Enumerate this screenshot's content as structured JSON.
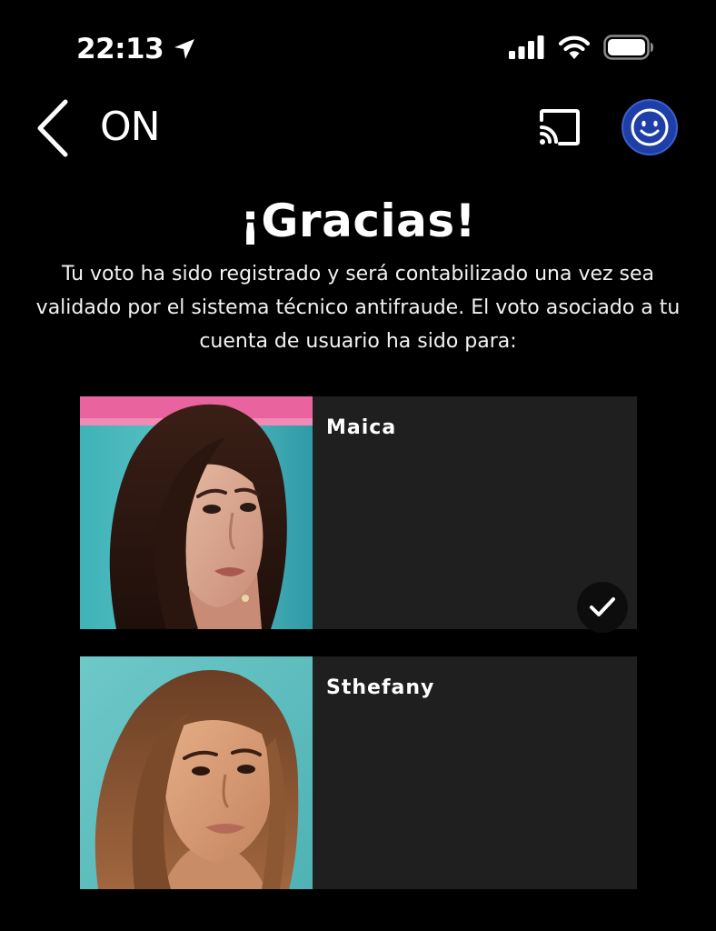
{
  "status_bar": {
    "time": "22:13",
    "icons": [
      "location-arrow-icon",
      "cellular-signal-icon",
      "wifi-icon",
      "battery-icon"
    ]
  },
  "nav": {
    "title": "ON",
    "back_icon": "chevron-left-icon",
    "cast_icon": "cast-icon",
    "avatar_icon": "smiley-avatar-icon",
    "avatar_color": "#1f3fa8"
  },
  "confirmation": {
    "title": "¡Gracias!",
    "message": "Tu voto ha sido registrado y será contabilizado una vez sea validado por el sistema técnico antifraude. El voto asociado a tu cuenta de usuario ha sido para:"
  },
  "contestants": [
    {
      "name": "Maica",
      "selected": true,
      "selected_icon": "checkmark-icon"
    },
    {
      "name": "Sthefany",
      "selected": false
    }
  ],
  "colors": {
    "background": "#000000",
    "card_background": "#1f1f1f",
    "text": "#ffffff"
  }
}
